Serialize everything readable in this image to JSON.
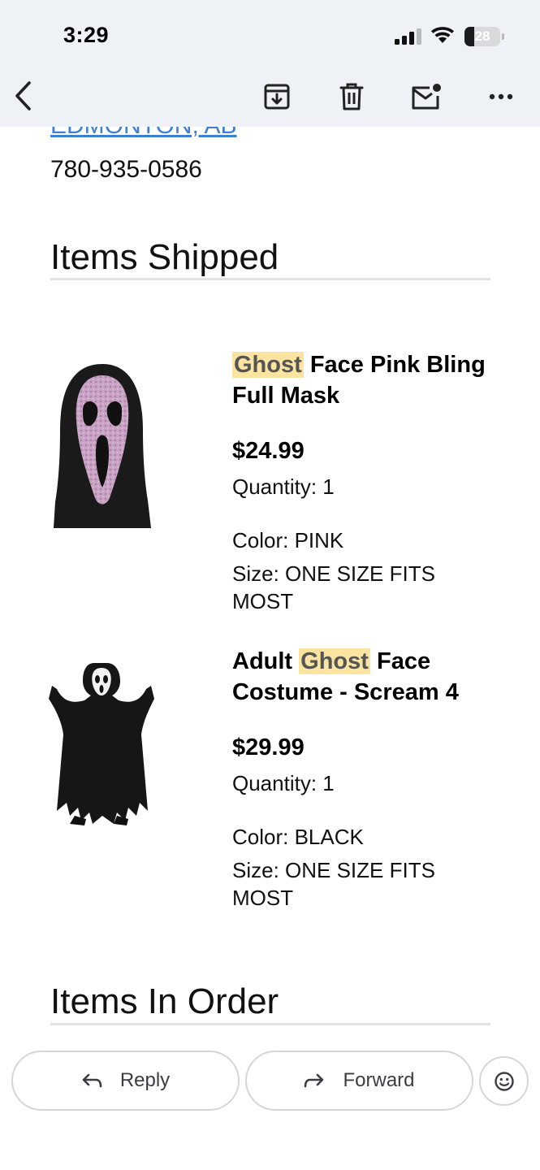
{
  "status_bar": {
    "time": "3:29",
    "battery_level": "28"
  },
  "toolbar": {
    "icons": [
      "back-arrow-icon",
      "archive-icon",
      "trash-icon",
      "mark-unread-icon",
      "more-icon"
    ]
  },
  "email": {
    "address_city": "EDMONTON, AB",
    "phone": "780-935-0586",
    "sections": {
      "shipped_title": "Items Shipped",
      "order_title": "Items In Order"
    },
    "items": [
      {
        "name_pre": "",
        "name_highlight": "Ghost",
        "name_post": " Face Pink Bling Full Mask",
        "price": "$24.99",
        "quantity": "Quantity: 1",
        "color": "Color: PINK",
        "size": "Size: ONE SIZE FITS MOST",
        "image": "pink-bling-ghost-face-mask"
      },
      {
        "name_pre": "Adult ",
        "name_highlight": "Ghost",
        "name_post": " Face Costume - Scream 4",
        "price": "$29.99",
        "quantity": "Quantity: 1",
        "color": "Color: BLACK",
        "size": "Size: ONE SIZE FITS MOST",
        "image": "ghost-face-costume"
      }
    ]
  },
  "actions": {
    "reply_label": "Reply",
    "forward_label": "Forward"
  },
  "colors": {
    "link": "#3b7fd6",
    "highlight": "#fbe3a0",
    "toolbar_bg": "#eef1f6"
  }
}
